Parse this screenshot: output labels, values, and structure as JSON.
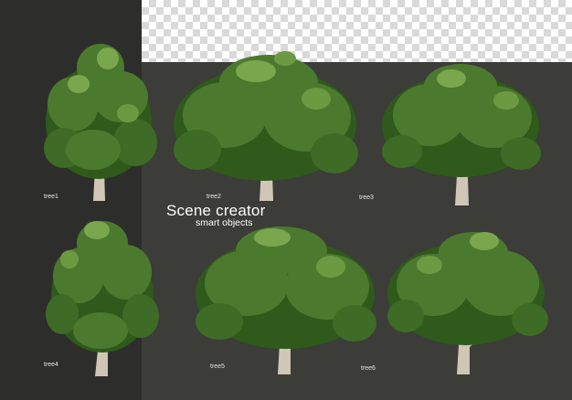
{
  "title": "Scene creator",
  "subtitle": "smart objects",
  "trees": [
    {
      "label": "tree1",
      "icon": "tree-icon"
    },
    {
      "label": "tree2",
      "icon": "tree-icon"
    },
    {
      "label": "tree3",
      "icon": "tree-icon"
    },
    {
      "label": "tree4",
      "icon": "tree-icon"
    },
    {
      "label": "tree5",
      "icon": "tree-icon"
    },
    {
      "label": "tree6",
      "icon": "tree-icon"
    }
  ],
  "colors": {
    "canvas": "#3c3c39",
    "left_panel": "#2d2e2c",
    "foliage_dark": "#2f5a1c",
    "foliage_mid": "#4b7a2e",
    "foliage_light": "#7aa64e",
    "trunk": "#cfc6b6"
  }
}
